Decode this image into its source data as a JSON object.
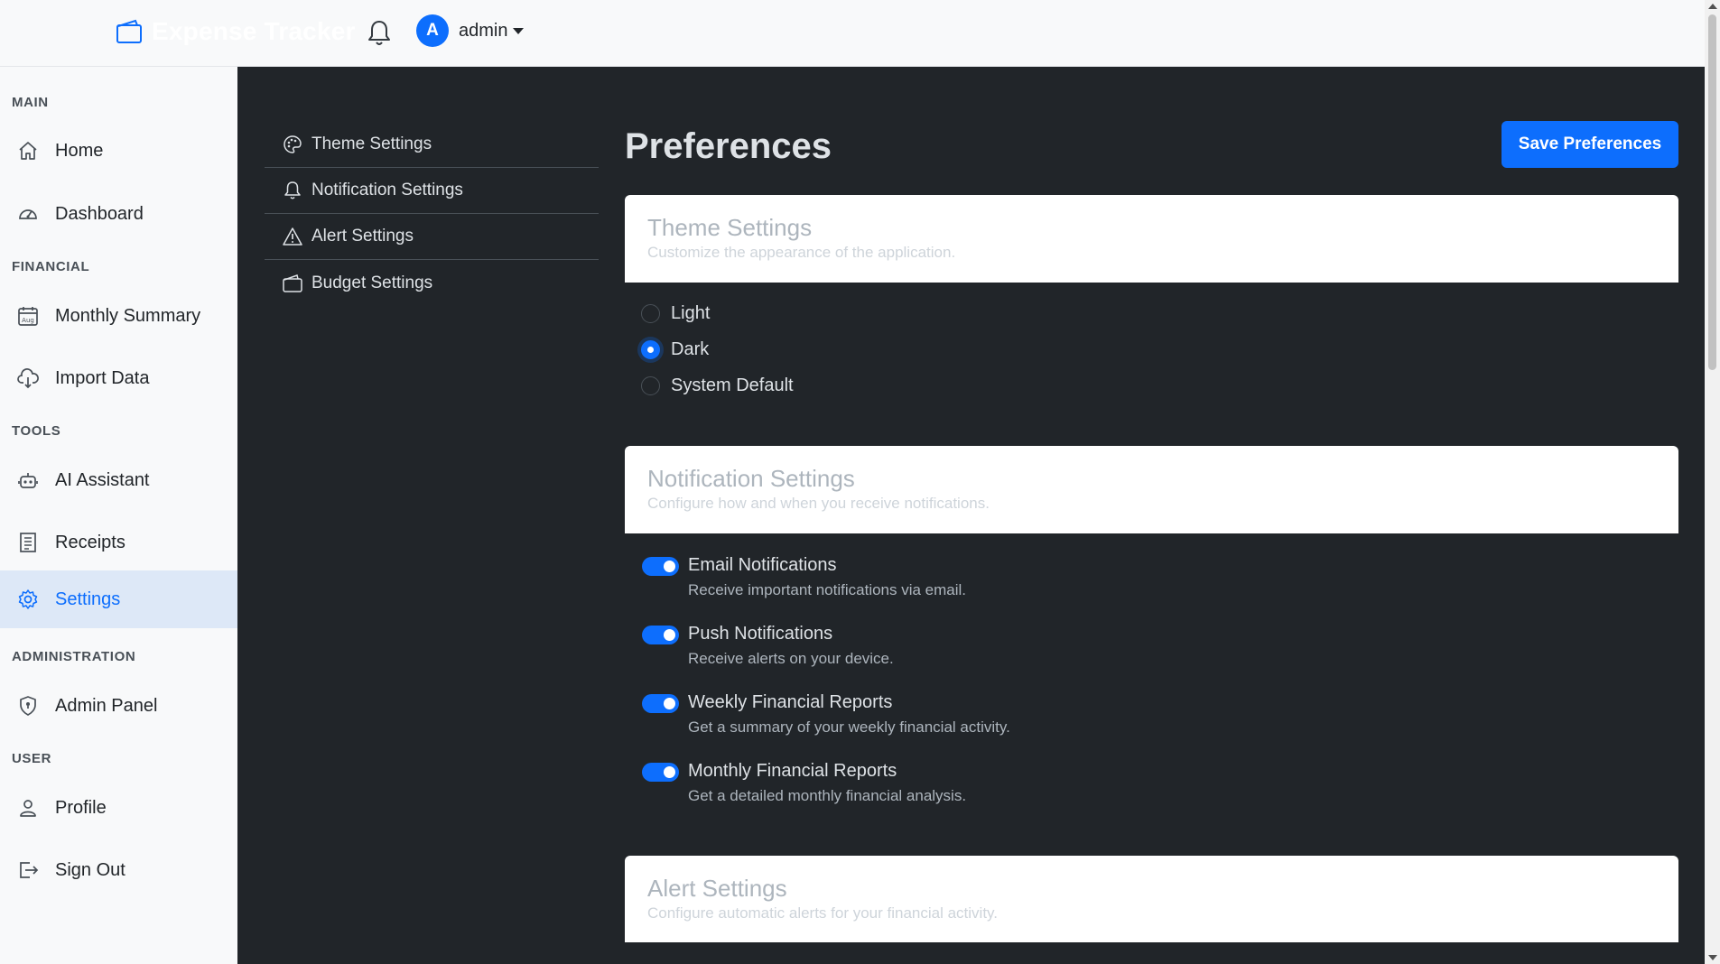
{
  "colors": {
    "accent": "#0d6efd",
    "dark_bg": "#212529",
    "sidebar_bg": "#f8f9fa",
    "active_bg": "#dde8f7"
  },
  "header": {
    "brand_icon": "wallet-icon",
    "brand_name": "Expense Tracker",
    "notifications_icon": "bell-icon",
    "user_initial": "A",
    "user_name": "admin"
  },
  "sidebar": {
    "sections": [
      {
        "title": "MAIN",
        "items": [
          {
            "label": "Home",
            "icon": "house-icon"
          },
          {
            "label": "Dashboard",
            "icon": "speedometer-icon"
          }
        ]
      },
      {
        "title": "FINANCIAL",
        "items": [
          {
            "label": "Monthly Summary",
            "icon": "calendar-icon"
          },
          {
            "label": "Import Data",
            "icon": "cloud-download-icon"
          }
        ]
      },
      {
        "title": "TOOLS",
        "items": [
          {
            "label": "AI Assistant",
            "icon": "robot-icon"
          },
          {
            "label": "Receipts",
            "icon": "receipt-icon"
          },
          {
            "label": "Settings",
            "icon": "gear-icon",
            "active": true
          }
        ]
      },
      {
        "title": "ADMINISTRATION",
        "items": [
          {
            "label": "Admin Panel",
            "icon": "shield-icon"
          }
        ]
      },
      {
        "title": "USER",
        "items": [
          {
            "label": "Profile",
            "icon": "person-icon"
          },
          {
            "label": "Sign Out",
            "icon": "sign-out-icon"
          }
        ]
      }
    ]
  },
  "settings_nav": [
    {
      "label": "Theme Settings",
      "icon": "palette-icon"
    },
    {
      "label": "Notification Settings",
      "icon": "bell-icon"
    },
    {
      "label": "Alert Settings",
      "icon": "warning-icon"
    },
    {
      "label": "Budget Settings",
      "icon": "wallet-icon"
    }
  ],
  "page": {
    "title": "Preferences",
    "save_label": "Save Preferences"
  },
  "theme_card": {
    "title": "Theme Settings",
    "subtitle": "Customize the appearance of the application.",
    "options": [
      {
        "label": "Light",
        "checked": false
      },
      {
        "label": "Dark",
        "checked": true
      },
      {
        "label": "System Default",
        "checked": false
      }
    ]
  },
  "notification_card": {
    "title": "Notification Settings",
    "subtitle": "Configure how and when you receive notifications.",
    "toggles": [
      {
        "label": "Email Notifications",
        "desc": "Receive important notifications via email.",
        "on": true
      },
      {
        "label": "Push Notifications",
        "desc": "Receive alerts on your device.",
        "on": true
      },
      {
        "label": "Weekly Financial Reports",
        "desc": "Get a summary of your weekly financial activity.",
        "on": true
      },
      {
        "label": "Monthly Financial Reports",
        "desc": "Get a detailed monthly financial analysis.",
        "on": true
      }
    ]
  },
  "alert_card": {
    "title": "Alert Settings",
    "subtitle": "Configure automatic alerts for your financial activity."
  }
}
